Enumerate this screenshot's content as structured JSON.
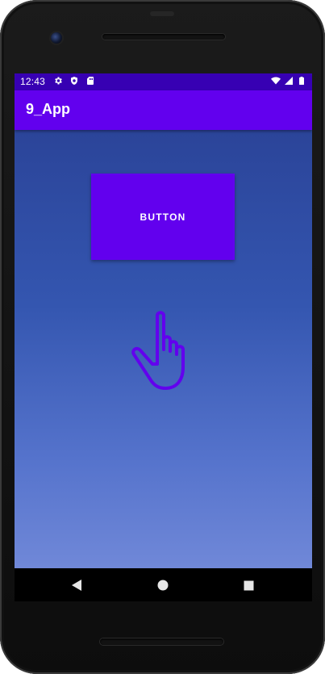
{
  "device": {
    "type": "android-phone-emulator"
  },
  "status_bar": {
    "time": "12:43",
    "left_icons": [
      "settings-icon",
      "shield-icon",
      "sim-card-icon"
    ],
    "right_icons": [
      "wifi-icon",
      "signal-icon",
      "battery-icon"
    ],
    "background": "#3700b3"
  },
  "app_bar": {
    "title": "9_App",
    "background": "#6200ee"
  },
  "main": {
    "button_label": "BUTTON",
    "button_color": "#6200ee",
    "hand_icon": "pointing-hand-icon",
    "hand_color": "#6200ee",
    "background_gradient": [
      "#2b4499",
      "#7088d8"
    ]
  },
  "navigation_bar": {
    "items": [
      "back-icon",
      "home-icon",
      "recents-icon"
    ]
  }
}
